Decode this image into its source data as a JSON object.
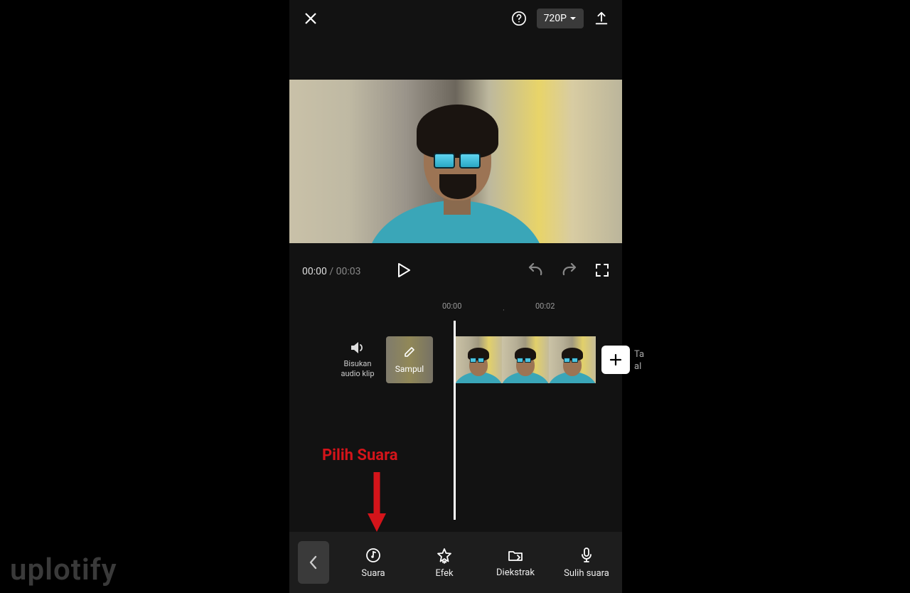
{
  "topbar": {
    "resolution": "720P"
  },
  "playback": {
    "current": "00:00",
    "separator": " / ",
    "duration": "00:03"
  },
  "ruler": {
    "t0": "00:00",
    "t1": "00:02"
  },
  "timeline": {
    "mute_line1": "Bisukan",
    "mute_line2": "audio klip",
    "cover_label": "Sampul",
    "tail_line1": "Ta",
    "tail_line2": "al"
  },
  "annotation": {
    "text": "Pilih Suara"
  },
  "toolbar": {
    "suara": "Suara",
    "efek": "Efek",
    "diekstrak": "Diekstrak",
    "sulih": "Sulih suara"
  },
  "watermark": {
    "part1": "uplo",
    "part2": "tify"
  }
}
